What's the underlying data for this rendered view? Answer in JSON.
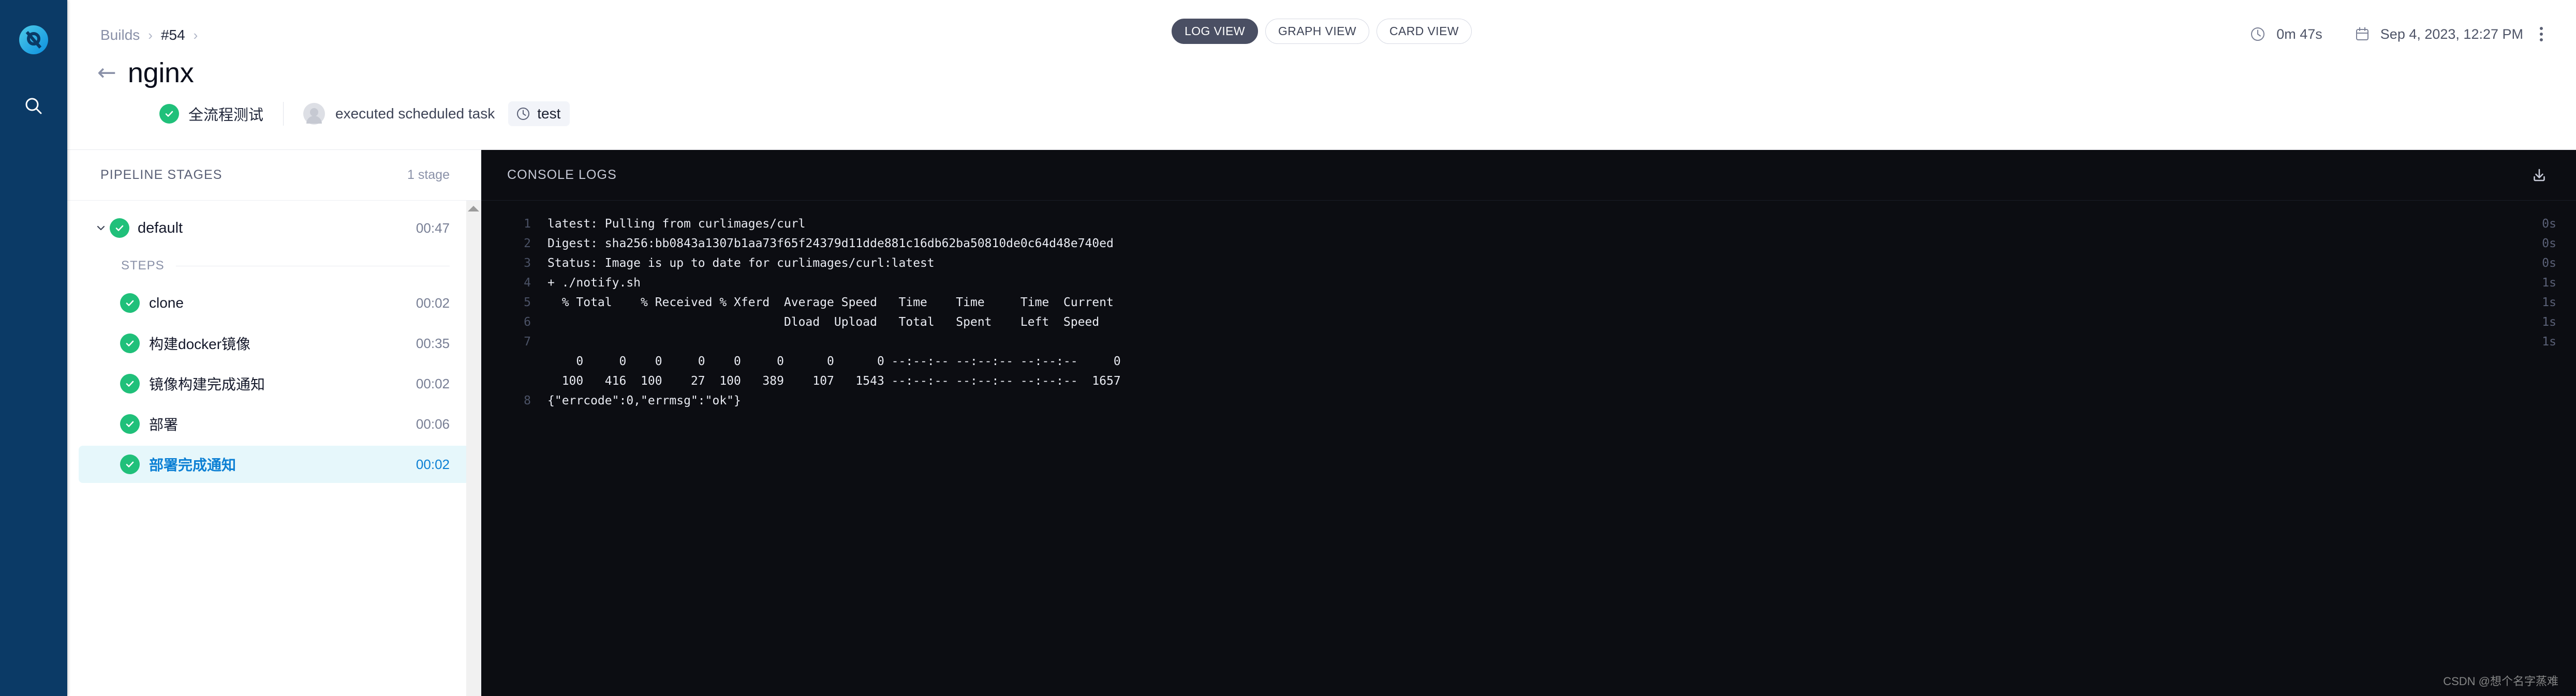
{
  "rail": {
    "logo_icon": "harness-logo-icon",
    "search_icon": "search-icon"
  },
  "header": {
    "breadcrumb": {
      "root_label": "Builds",
      "separator": "›",
      "current_label": "#54",
      "trailing_separator": "›"
    },
    "back_arrow": "←",
    "title": "nginx",
    "status_icon": "check-circle-icon",
    "pipeline_name": "全流程测试",
    "actor_avatar": "avatar-icon",
    "actor_label": "executed scheduled task",
    "tag_icon": "clock-icon",
    "tag_label": "test",
    "views": [
      {
        "label": "LOG VIEW",
        "active": true
      },
      {
        "label": "GRAPH VIEW",
        "active": false
      },
      {
        "label": "CARD VIEW",
        "active": false
      }
    ],
    "duration_icon": "clock-icon",
    "duration": "0m 47s",
    "date_icon": "calendar-icon",
    "date": "Sep 4, 2023, 12:27 PM",
    "more_icon": "kebab-menu-icon"
  },
  "stages_panel": {
    "title": "PIPELINE STAGES",
    "count_label": "1 stage",
    "stage": {
      "caret_icon": "chevron-down-icon",
      "status_icon": "check-circle-icon",
      "name": "default",
      "time": "00:47"
    },
    "steps_label": "STEPS",
    "steps": [
      {
        "status_icon": "check-circle-icon",
        "name": "clone",
        "time": "00:02",
        "selected": false
      },
      {
        "status_icon": "check-circle-icon",
        "name": "构建docker镜像",
        "time": "00:35",
        "selected": false
      },
      {
        "status_icon": "check-circle-icon",
        "name": "镜像构建完成通知",
        "time": "00:02",
        "selected": false
      },
      {
        "status_icon": "check-circle-icon",
        "name": "部署",
        "time": "00:06",
        "selected": false
      },
      {
        "status_icon": "check-circle-icon",
        "name": "部署完成通知",
        "time": "00:02",
        "selected": true
      }
    ]
  },
  "console": {
    "title": "CONSOLE LOGS",
    "download_icon": "download-icon",
    "lines": [
      {
        "n": "1",
        "text": "latest: Pulling from curlimages/curl",
        "ts": "0s"
      },
      {
        "n": "2",
        "text": "Digest: sha256:bb0843a1307b1aa73f65f24379d11dde881c16db62ba50810de0c64d48e740ed",
        "ts": "0s"
      },
      {
        "n": "3",
        "text": "Status: Image is up to date for curlimages/curl:latest",
        "ts": "0s"
      },
      {
        "n": "4",
        "text": "+ ./notify.sh",
        "ts": "1s"
      },
      {
        "n": "5",
        "text": "  % Total    % Received % Xferd  Average Speed   Time    Time     Time  Current",
        "ts": "1s"
      },
      {
        "n": "6",
        "text": "                                 Dload  Upload   Total   Spent    Left  Speed",
        "ts": "1s"
      },
      {
        "n": "7",
        "text": "",
        "ts": "1s"
      },
      {
        "n": "",
        "text": "    0     0    0     0    0     0      0      0 --:--:-- --:--:-- --:--:--     0",
        "ts": ""
      },
      {
        "n": "",
        "text": "  100   416  100    27  100   389    107   1543 --:--:-- --:--:-- --:--:--  1657",
        "ts": ""
      },
      {
        "n": "8",
        "text": "{\"errcode\":0,\"errmsg\":\"ok\"}",
        "ts": ""
      }
    ]
  },
  "watermark": "CSDN @想个名字蒸难",
  "colors": {
    "rail_bg": "#0b3a66",
    "console_bg": "#0c0d12",
    "success_green": "#20c07a",
    "selected_step_bg": "#e6f7fb",
    "selected_step_text": "#0b7fd4",
    "active_pill_bg": "#4a4f63"
  }
}
